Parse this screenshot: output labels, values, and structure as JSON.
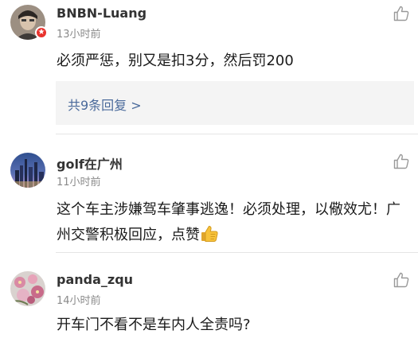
{
  "comments": [
    {
      "username": "BNBN-Luang",
      "time": "13小时前",
      "text": "必须严惩，别又是扣3分，然后罚200",
      "replies_label": "共9条回复 >",
      "avatar_icon": "avatar-user-photo",
      "badge_icon": "verified-badge-icon"
    },
    {
      "username": "golf在广州",
      "time": "11小时前",
      "text": "这个车主涉嫌驾车肇事逃逸！必须处理，以儆效尤！广州交警积极回应，点赞",
      "text_emoji": "thumbs-up-emoji",
      "avatar_icon": "avatar-city-skyline"
    },
    {
      "username": "panda_zqu",
      "time": "14小时前",
      "text": "开车门不看不是车内人全责吗?",
      "avatar_icon": "avatar-flowers"
    }
  ],
  "colors": {
    "link": "#4a6a9b",
    "meta": "#8a8a8a",
    "badge": "#e8322d",
    "reply_bg": "#f4f4f4"
  }
}
